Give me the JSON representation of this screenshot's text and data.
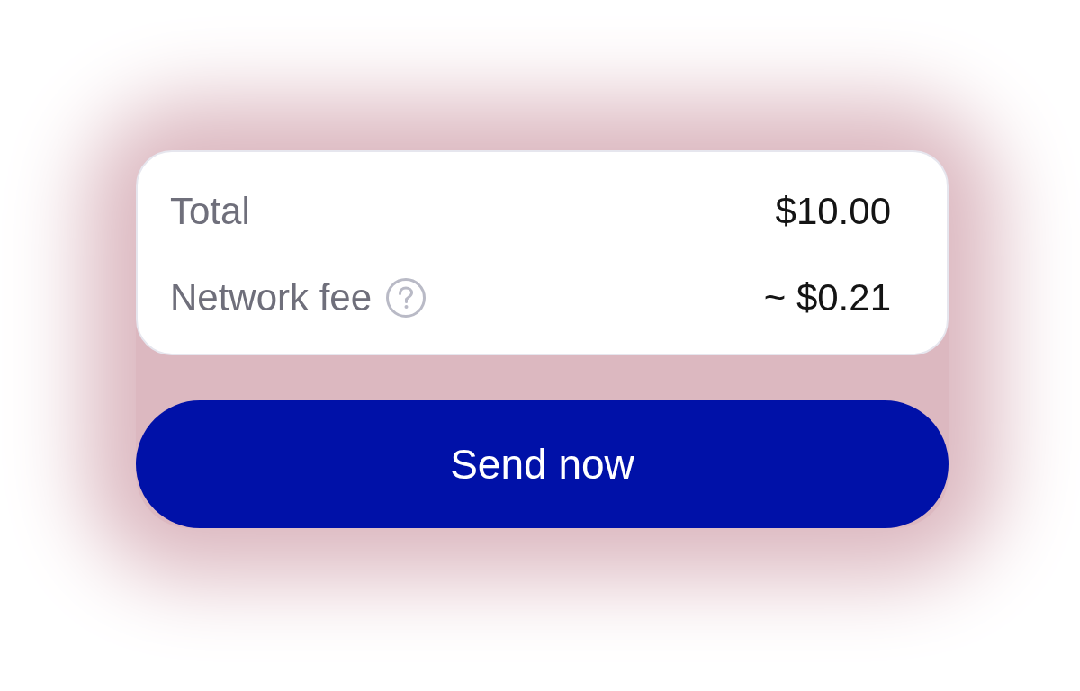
{
  "summary": {
    "rows": [
      {
        "label": "Total",
        "value": "$10.00",
        "help_icon": false
      },
      {
        "label": "Network fee",
        "value": "~ $0.21",
        "help_icon": true
      }
    ]
  },
  "send_button": {
    "label": "Send now"
  }
}
